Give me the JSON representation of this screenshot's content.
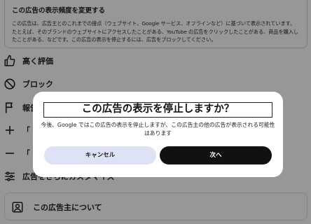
{
  "info": {
    "title": "この広告の表示頻度を変更する",
    "body": "この広告は、広告主とのこれまでの接点（ウェブサイト、Google サービス、オフラインなど）に基づいて表示されています。たとえば、そのブランドのウェブサイトにアクセスしたことがある、YouTube の広告をクリックしたことがある、商品を購入したことがある、などです。この広告の表示を停止するには、広告をブロックしてください。"
  },
  "menu": {
    "like_label": "高く評価",
    "block_label": "ブロック",
    "report_label": "報告",
    "increase_label": "「",
    "decrease_label": "「",
    "customize_label": "広告をさらにカスタマイズ",
    "advertiser_label": "この広告主について"
  },
  "icons": {
    "like": "thumb-up-icon",
    "block": "block-icon",
    "report": "flag-icon",
    "increase": "plus-icon",
    "decrease": "minus-icon",
    "customize": "tune-icon",
    "advertiser": "person-box-icon"
  },
  "dialog": {
    "title": "この広告の表示を停止しますか？",
    "message": "今後、Google ではこの広告の表示を停止しますが、この広告主の他の広告が表示される可能性はあります",
    "cancel_label": "キャンセル",
    "next_label": "次へ"
  },
  "colors": {
    "overlay": "#000000",
    "cancel_button": "#dde3f5",
    "next_button": "#111111"
  }
}
